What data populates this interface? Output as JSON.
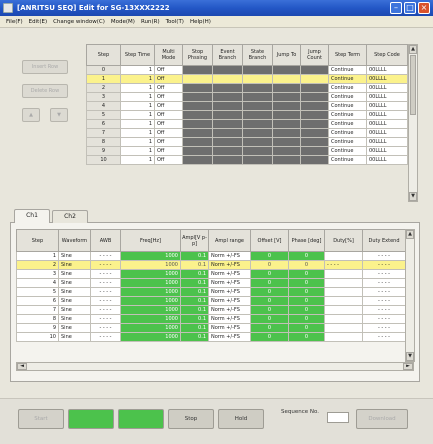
{
  "window": {
    "title": "[ANRITSU SEQ] Edit for SG-13XXX2222"
  },
  "menu": [
    "File(F)",
    "Edit(E)",
    "Change window(C)",
    "Mode(M)",
    "Run(R)",
    "Tool(T)",
    "Help(H)"
  ],
  "side_buttons": [
    "Insert Row",
    "Delete Row",
    "▲",
    "▼"
  ],
  "step_table": {
    "headers": [
      "Step",
      "Step Time",
      "Multi Mode",
      "Stop Phssing",
      "Event Branch",
      "State Branch",
      "Jump To",
      "Jump Count",
      "Step Term",
      "Step Code"
    ],
    "rows": [
      [
        "0",
        "1",
        "Off",
        "",
        "",
        "",
        "",
        "",
        "Continue",
        "00LLLL"
      ],
      [
        "1",
        "1",
        "Off",
        "",
        "",
        "",
        "",
        "",
        "Continue",
        "00LLLL"
      ],
      [
        "2",
        "1",
        "Off",
        "",
        "",
        "",
        "",
        "",
        "Continue",
        "00LLLL"
      ],
      [
        "3",
        "1",
        "Off",
        "",
        "",
        "",
        "",
        "",
        "Continue",
        "00LLLL"
      ],
      [
        "4",
        "1",
        "Off",
        "",
        "",
        "",
        "",
        "",
        "Continue",
        "00LLLL"
      ],
      [
        "5",
        "1",
        "Off",
        "",
        "",
        "",
        "",
        "",
        "Continue",
        "00LLLL"
      ],
      [
        "6",
        "1",
        "Off",
        "",
        "",
        "",
        "",
        "",
        "Continue",
        "00LLLL"
      ],
      [
        "7",
        "1",
        "Off",
        "",
        "",
        "",
        "",
        "",
        "Continue",
        "00LLLL"
      ],
      [
        "8",
        "1",
        "Off",
        "",
        "",
        "",
        "",
        "",
        "Continue",
        "00LLLL"
      ],
      [
        "9",
        "1",
        "Off",
        "",
        "",
        "",
        "",
        "",
        "Continue",
        "00LLLL"
      ],
      [
        "10",
        "1",
        "Off",
        "",
        "",
        "",
        "",
        "",
        "Continue",
        "00LLLL"
      ]
    ],
    "selected_row": 1
  },
  "tabs": [
    "Ch1",
    "Ch2"
  ],
  "channel_table": {
    "headers": [
      "Step",
      "Waveform",
      "AWB",
      "Freq[Hz]",
      "Ampl[V p-p]",
      "Ampl range",
      "Offset [V]",
      "Phase [deg]",
      "Duty[%]",
      "Duty Extend"
    ],
    "rows": [
      [
        "1",
        "Sine",
        "- - - -",
        "1000",
        "0.1",
        "Norm +/-FS",
        "0",
        "0",
        "",
        "- - - -"
      ],
      [
        "2",
        "Sine",
        "- - - -",
        "1000",
        "0.1",
        "Norm +/-FS",
        "0",
        "0",
        "- - - -",
        "- - - -"
      ],
      [
        "3",
        "Sine",
        "- - - -",
        "1000",
        "0.1",
        "Norm +/-FS",
        "0",
        "0",
        "",
        "- - - -"
      ],
      [
        "4",
        "Sine",
        "- - - -",
        "1000",
        "0.1",
        "Norm +/-FS",
        "0",
        "0",
        "",
        "- - - -"
      ],
      [
        "5",
        "Sine",
        "- - - -",
        "1000",
        "0.1",
        "Norm +/-FS",
        "0",
        "0",
        "",
        "- - - -"
      ],
      [
        "6",
        "Sine",
        "- - - -",
        "1000",
        "0.1",
        "Norm +/-FS",
        "0",
        "0",
        "",
        "- - - -"
      ],
      [
        "7",
        "Sine",
        "- - - -",
        "1000",
        "0.1",
        "Norm +/-FS",
        "0",
        "0",
        "",
        "- - - -"
      ],
      [
        "8",
        "Sine",
        "- - - -",
        "1000",
        "0.1",
        "Norm +/-FS",
        "0",
        "0",
        "",
        "- - - -"
      ],
      [
        "9",
        "Sine",
        "- - - -",
        "1000",
        "0.1",
        "Norm +/-FS",
        "0",
        "0",
        "",
        "- - - -"
      ],
      [
        "10",
        "Sine",
        "- - - -",
        "1000",
        "0.1",
        "Norm +/-FS",
        "0",
        "0",
        "",
        "- - - -"
      ]
    ],
    "selected_row": 1
  },
  "bottom": {
    "buttons": [
      "Start",
      "",
      "",
      "Stop",
      "Hold"
    ],
    "sequence_label": "Sequence No.",
    "sequence_no": "",
    "right_button": "Download"
  },
  "colors": {
    "titlebar": "#2357c6",
    "selection": "#fbf28c",
    "active_cell": "#4cc24c",
    "inactive_cell": "#6e6e6e"
  }
}
